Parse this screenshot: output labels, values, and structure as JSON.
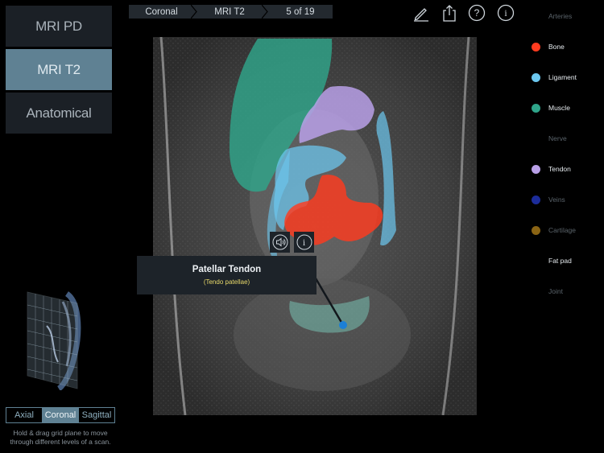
{
  "modes": [
    {
      "label": "MRI PD",
      "active": false
    },
    {
      "label": "MRI T2",
      "active": true
    },
    {
      "label": "Anatomical",
      "active": false
    }
  ],
  "breadcrumb": {
    "plane": "Coronal",
    "scan": "MRI T2",
    "slice": "5 of 19"
  },
  "toolbar": {
    "icons": [
      "pencil-icon",
      "share-icon",
      "help-icon",
      "info-icon"
    ],
    "help_glyph": "?",
    "info_glyph": "i"
  },
  "legend": [
    {
      "label": "Arteries",
      "color": null,
      "enabled": false
    },
    {
      "label": "Bone",
      "color": "#ff3b1f",
      "enabled": true
    },
    {
      "label": "Ligament",
      "color": "#6cc8f0",
      "enabled": true
    },
    {
      "label": "Muscle",
      "color": "#2fa58a",
      "enabled": true
    },
    {
      "label": "Nerve",
      "color": null,
      "enabled": false
    },
    {
      "label": "Tendon",
      "color": "#b9a0e8",
      "enabled": true
    },
    {
      "label": "Veins",
      "color": "#1c2c9a",
      "enabled": false
    },
    {
      "label": "Cartilage",
      "color": "#8a6414",
      "enabled": false
    },
    {
      "label": "Fat pad",
      "color": null,
      "enabled": true
    },
    {
      "label": "Joint",
      "color": null,
      "enabled": false
    }
  ],
  "popup": {
    "title": "Patellar Tendon",
    "subtitle": "(Tendo patellae)",
    "buttons": [
      "speaker-icon",
      "info-icon"
    ]
  },
  "planes": [
    {
      "label": "Axial",
      "active": false
    },
    {
      "label": "Coronal",
      "active": true
    },
    {
      "label": "Sagittal",
      "active": false
    }
  ],
  "hint": {
    "line1": "Hold & drag grid plane to move",
    "line2": "through different levels of a scan."
  },
  "colors": {
    "accent": "#5f8193",
    "panel": "#1b2026",
    "pin": "#1b7fd6"
  }
}
